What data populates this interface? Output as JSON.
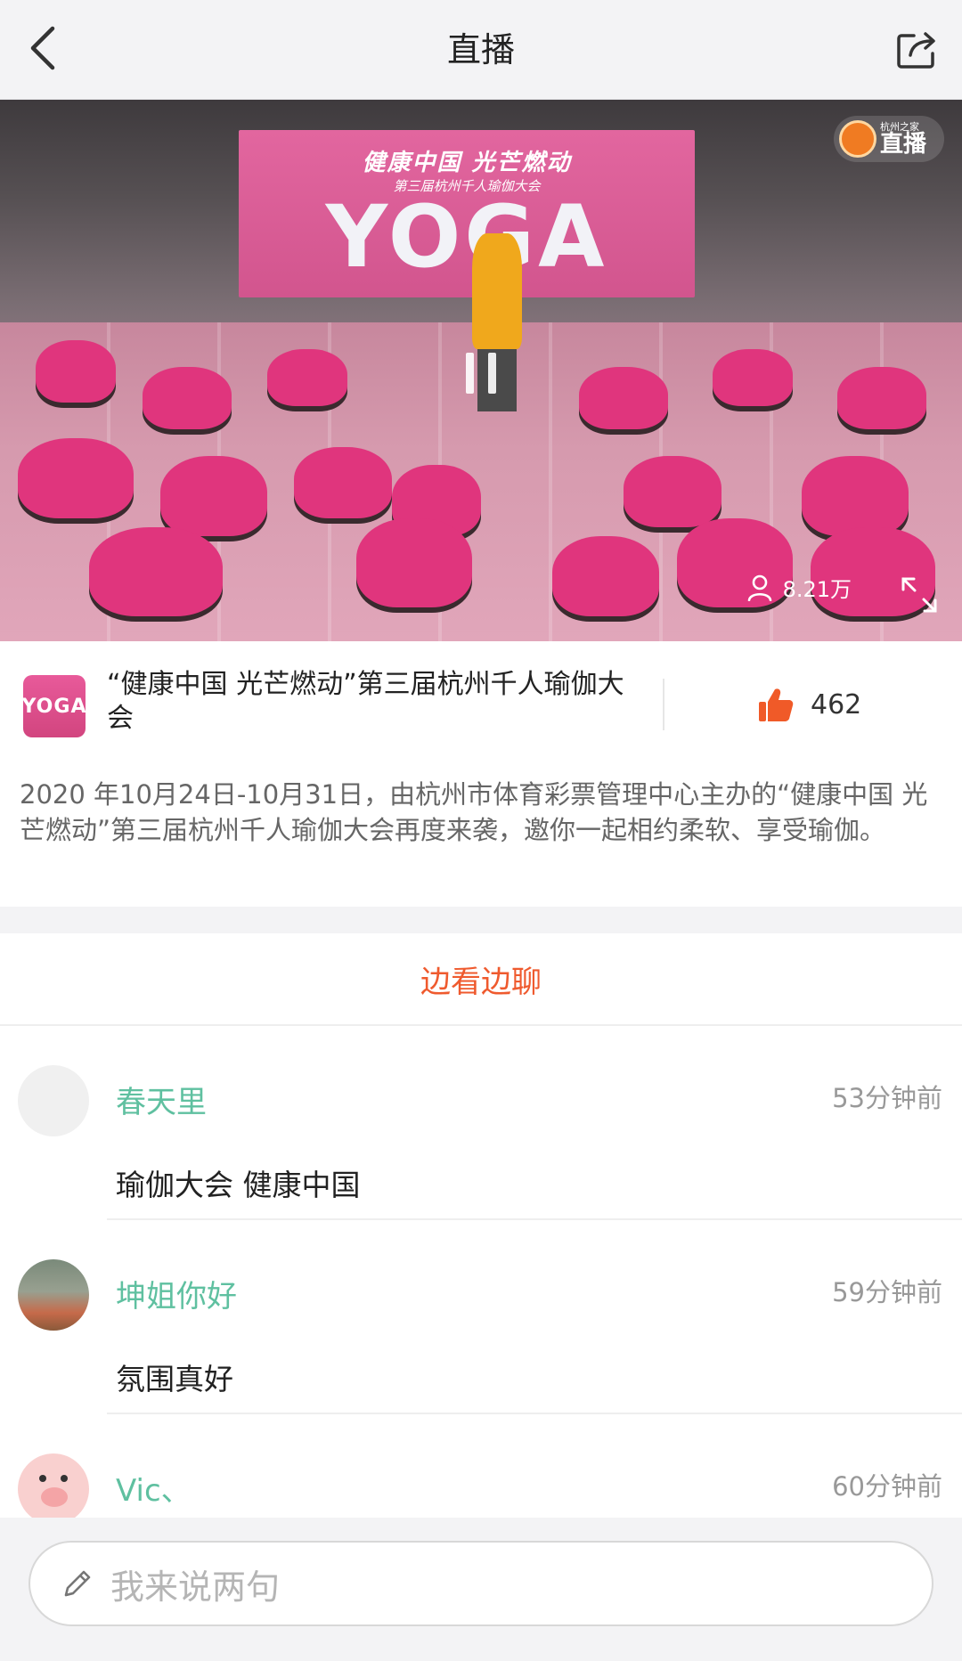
{
  "header": {
    "title": "直播",
    "back_icon": "chevron-left-icon",
    "share_icon": "share-icon"
  },
  "video": {
    "stage_line1": "健康中国 光芒燃动",
    "stage_line2": "第三届杭州千人瑜伽大会",
    "stage_big": "YOGA",
    "badge_brand": "杭州之家",
    "badge_text": "直播",
    "viewers": "8.21万",
    "state_icon": "pause-icon",
    "fullscreen_icon": "expand-icon"
  },
  "info": {
    "avatar_text": "YOGA",
    "title": "“健康中国 光芒燃动”第三届杭州千人瑜伽大会",
    "likes": "462",
    "like_color": "#f05a28",
    "description": "2020 年10月24日-10月31日，由杭州市体育彩票管理中心主办的“健康中国 光芒燃动”第三届杭州千人瑜伽大会再度来袭，邀你一起相约柔软、享受瑜伽。"
  },
  "chat": {
    "tab_label": "边看边聊",
    "accent_color": "#ef5a2e",
    "comments": [
      {
        "name": "春天里",
        "time": "53分钟前",
        "text": "瑜伽大会 健康中国"
      },
      {
        "name": "坤姐你好",
        "time": "59分钟前",
        "text": "氛围真好"
      },
      {
        "name": "Vic、",
        "time": "60分钟前",
        "text": ""
      }
    ]
  },
  "input": {
    "placeholder": "我来说两句",
    "icon": "pencil-icon"
  }
}
